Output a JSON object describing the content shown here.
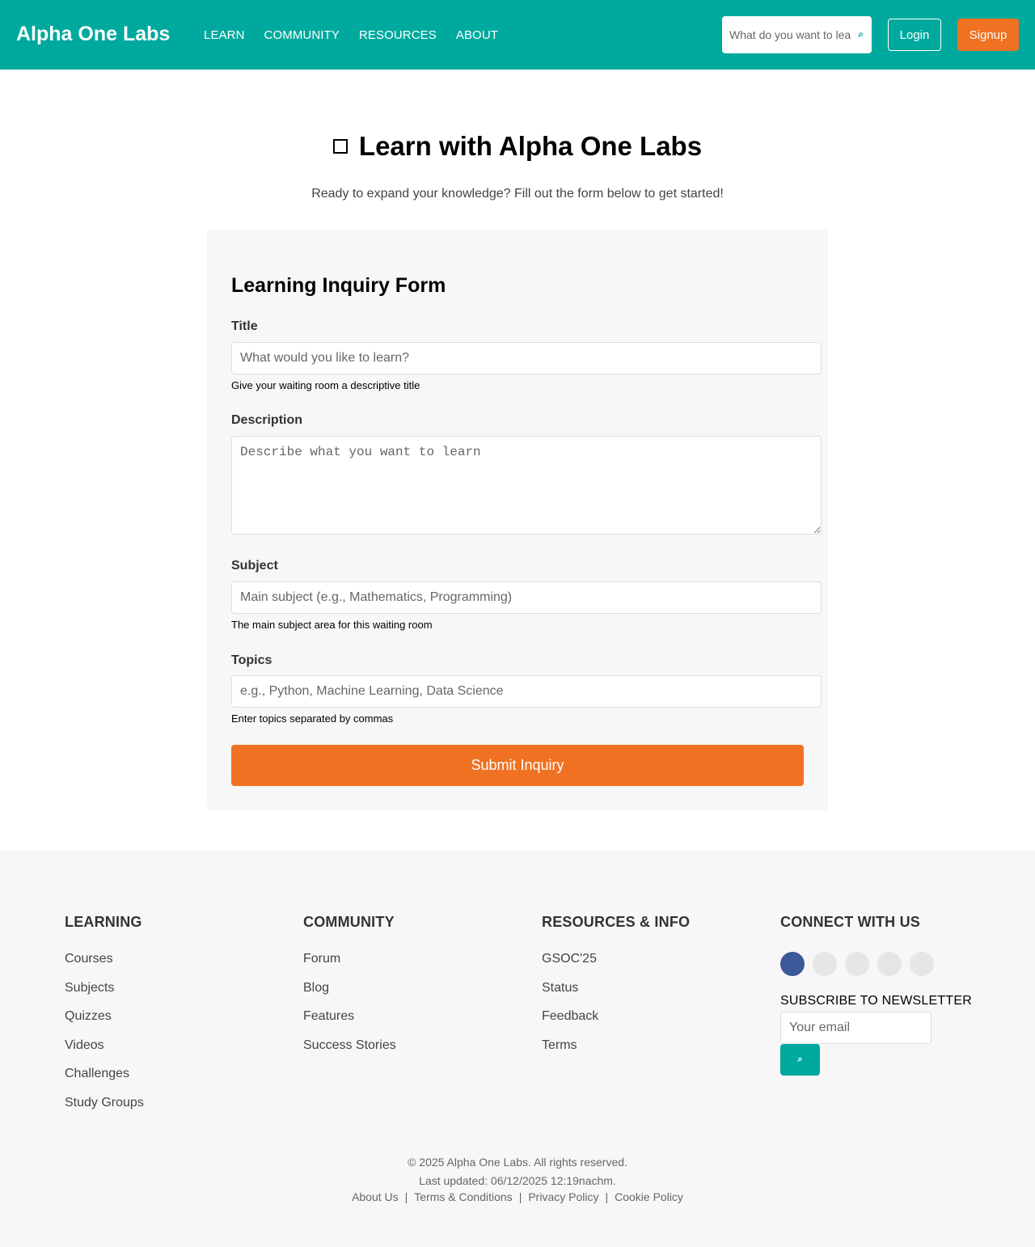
{
  "header": {
    "logo": "Alpha One Labs",
    "nav": [
      "LEARN",
      "COMMUNITY",
      "RESOURCES",
      "ABOUT"
    ],
    "search_placeholder": "What do you want to learn?",
    "login": "Login",
    "signup": "Signup",
    "accent_color": "#00a99d"
  },
  "hero": {
    "title": "Learn with Alpha One Labs",
    "subtitle": "Ready to expand your knowledge? Fill out the form below to get started!"
  },
  "form": {
    "title": "Learning Inquiry Form",
    "title_label": "Title",
    "title_placeholder": "What would you like to learn?",
    "title_help": "Give your waiting room a descriptive title",
    "description_label": "Description",
    "description_placeholder": "Describe what you want to learn",
    "subject_label": "Subject",
    "subject_placeholder": "Main subject (e.g., Mathematics, Programming)",
    "subject_help": "The main subject area for this waiting room",
    "topics_label": "Topics",
    "topics_placeholder": "e.g., Python, Machine Learning, Data Science",
    "topics_help": "Enter topics separated by commas",
    "submit": "Submit Inquiry",
    "submit_color": "#f07122"
  },
  "footer": {
    "learning": {
      "heading": "LEARNING",
      "items": [
        "Courses",
        "Subjects",
        "Quizzes",
        "Videos",
        "Challenges",
        "Study Groups"
      ]
    },
    "community": {
      "heading": "COMMUNITY",
      "items": [
        "Forum",
        "Blog",
        "Features",
        "Success Stories"
      ]
    },
    "resources": {
      "heading": "RESOURCES & INFO",
      "items": [
        "GSOC'25",
        "Status",
        "Feedback",
        "Terms"
      ]
    },
    "connect": {
      "heading": "CONNECT WITH US",
      "social_icons": [
        "facebook-icon",
        "social-icon",
        "social-icon",
        "social-icon",
        "social-icon"
      ],
      "newsletter_title": "SUBSCRIBE TO NEWSLETTER",
      "email_placeholder": "Your email"
    },
    "copyright": "© 2025 Alpha One Labs. All rights reserved.",
    "updated": "Last updated: 06/12/2025 12:19nachm.",
    "legal_links": [
      "About Us",
      "Terms & Conditions",
      "Privacy Policy",
      "Cookie Policy"
    ]
  }
}
